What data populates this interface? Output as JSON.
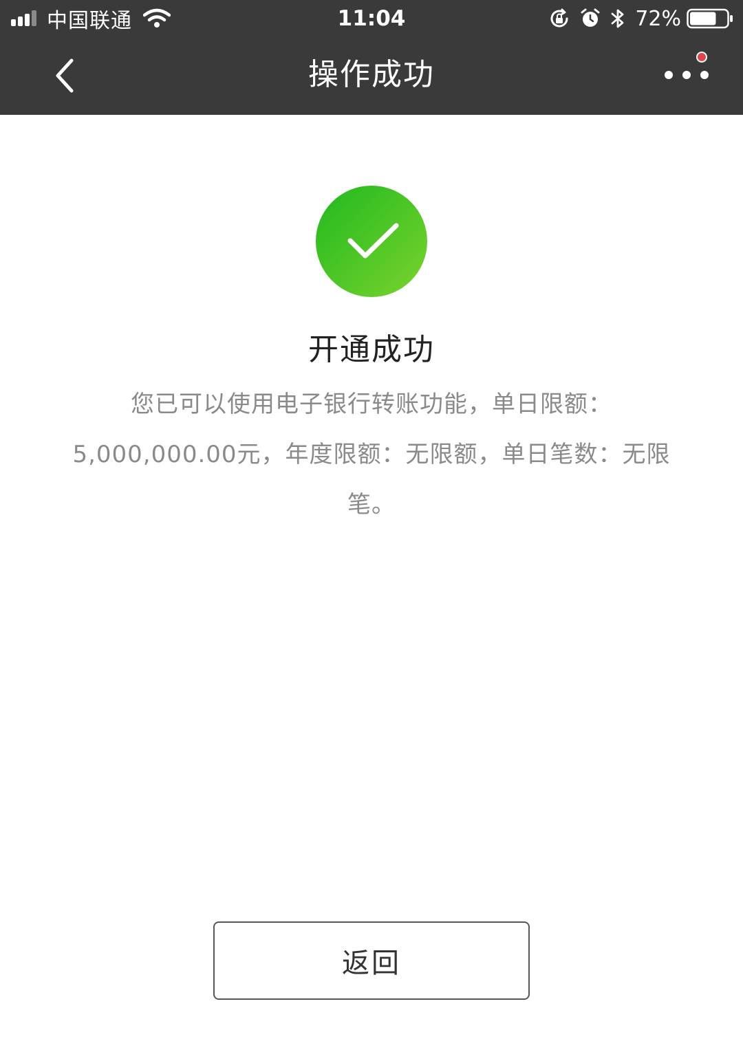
{
  "status_bar": {
    "carrier": "中国联通",
    "time": "11:04",
    "battery_percent": "72%",
    "battery_level": 0.72,
    "icons": [
      "signal-icon",
      "wifi-icon",
      "lock-rotation-icon",
      "alarm-icon",
      "bluetooth-icon",
      "battery-icon"
    ]
  },
  "nav": {
    "title": "操作成功",
    "back_icon": "chevron-left-icon",
    "more_icon": "more-dots-icon",
    "notification_dot_color": "#e0444c"
  },
  "result": {
    "icon": "checkmark-circle-icon",
    "title": "开通成功",
    "description": "您已可以使用电子银行转账功能，单日限额：5,000,000.00元，年度限额：无限额，单日笔数：无限笔。",
    "success_color_start": "#1fb91f",
    "success_color_end": "#7bd32d"
  },
  "actions": {
    "return_label": "返回"
  },
  "colors": {
    "header_bg": "#3a3a3a",
    "text_muted": "#8a8a8a"
  }
}
